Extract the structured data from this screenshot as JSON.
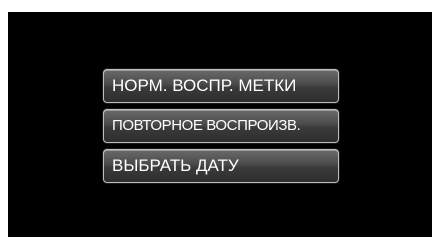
{
  "menu": {
    "items": [
      {
        "label": "НОРМ. ВОСПР. МЕТКИ"
      },
      {
        "label": "ПОВТОРНОЕ ВОСПРОИЗВ."
      },
      {
        "label": "ВЫБРАТЬ ДАТУ"
      }
    ]
  },
  "colors": {
    "screen_background": "#000000",
    "button_border": "#bdbdbd",
    "button_text": "#ffffff"
  }
}
